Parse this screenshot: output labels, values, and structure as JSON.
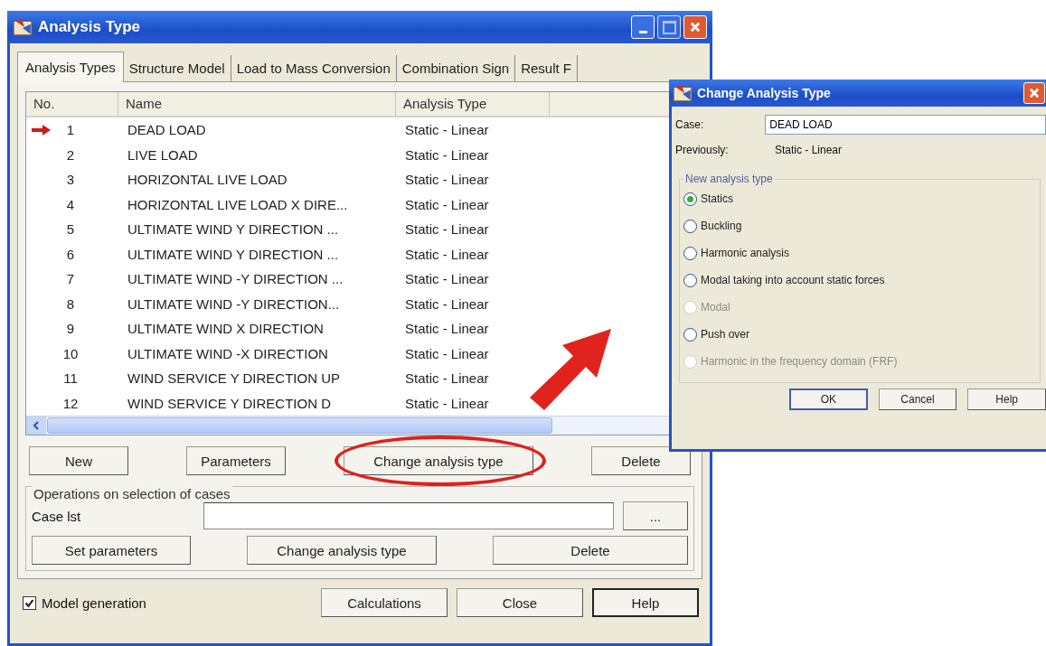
{
  "window": {
    "title": "Analysis Type"
  },
  "tabs": [
    {
      "label": "Analysis Types",
      "selected": true
    },
    {
      "label": "Structure Model",
      "selected": false
    },
    {
      "label": "Load to Mass Conversion",
      "selected": false
    },
    {
      "label": "Combination Sign",
      "selected": false
    },
    {
      "label": "Result F",
      "selected": false
    }
  ],
  "table": {
    "columns": [
      "No.",
      "Name",
      "Analysis Type"
    ],
    "rows": [
      {
        "no": "1",
        "name": "DEAD LOAD",
        "type": "Static - Linear",
        "current": true
      },
      {
        "no": "2",
        "name": "LIVE LOAD",
        "type": "Static - Linear",
        "current": false
      },
      {
        "no": "3",
        "name": "HORIZONTAL LIVE LOAD",
        "type": "Static - Linear",
        "current": false
      },
      {
        "no": "4",
        "name": "HORIZONTAL LIVE LOAD X DIRE...",
        "type": "Static - Linear",
        "current": false
      },
      {
        "no": "5",
        "name": "ULTIMATE WIND Y DIRECTION ...",
        "type": "Static - Linear",
        "current": false
      },
      {
        "no": "6",
        "name": "ULTIMATE WIND Y DIRECTION ...",
        "type": "Static - Linear",
        "current": false
      },
      {
        "no": "7",
        "name": "ULTIMATE WIND -Y DIRECTION ...",
        "type": "Static - Linear",
        "current": false
      },
      {
        "no": "8",
        "name": "ULTIMATE WIND  -Y DIRECTION...",
        "type": "Static - Linear",
        "current": false
      },
      {
        "no": "9",
        "name": "ULTIMATE WIND X DIRECTION",
        "type": "Static - Linear",
        "current": false
      },
      {
        "no": "10",
        "name": "ULTIMATE WIND -X DIRECTION",
        "type": "Static - Linear",
        "current": false
      },
      {
        "no": "11",
        "name": "WIND SERVICE Y DIRECTION UP",
        "type": "Static - Linear",
        "current": false
      },
      {
        "no": "12",
        "name": "WIND SERVICE Y DIRECTION D",
        "type": "Static - Linear",
        "current": false
      }
    ]
  },
  "case_buttons": [
    {
      "label": "New",
      "highlighted": false
    },
    {
      "label": "Parameters",
      "highlighted": false
    },
    {
      "label": "Change analysis type",
      "highlighted": true
    },
    {
      "label": "Delete",
      "highlighted": false
    }
  ],
  "selection_group": {
    "title": "Operations on selection of cases",
    "case_list_label": "Case lst",
    "browse_button": "...",
    "buttons": [
      "Set parameters",
      "Change analysis type",
      "Delete"
    ]
  },
  "model_generation": {
    "label": "Model generation",
    "checked": true
  },
  "footer_buttons": [
    "Calculations",
    "Close",
    "Help"
  ],
  "dialog": {
    "title": "Change Analysis Type",
    "case_label": "Case:",
    "case_value": "DEAD LOAD",
    "previously_label": "Previously:",
    "previously_value": "Static - Linear",
    "group_title": "New analysis type",
    "options": [
      {
        "label": "Statics",
        "selected": true,
        "disabled": false
      },
      {
        "label": "Buckling",
        "selected": false,
        "disabled": false
      },
      {
        "label": "Harmonic analysis",
        "selected": false,
        "disabled": false
      },
      {
        "label": "Modal taking into account static forces",
        "selected": false,
        "disabled": false
      },
      {
        "label": "Modal",
        "selected": false,
        "disabled": true
      },
      {
        "label": "Push over",
        "selected": false,
        "disabled": false
      },
      {
        "label": "Harmonic in the frequency domain (FRF)",
        "selected": false,
        "disabled": true
      }
    ],
    "buttons": [
      "OK",
      "Cancel",
      "Help"
    ]
  }
}
